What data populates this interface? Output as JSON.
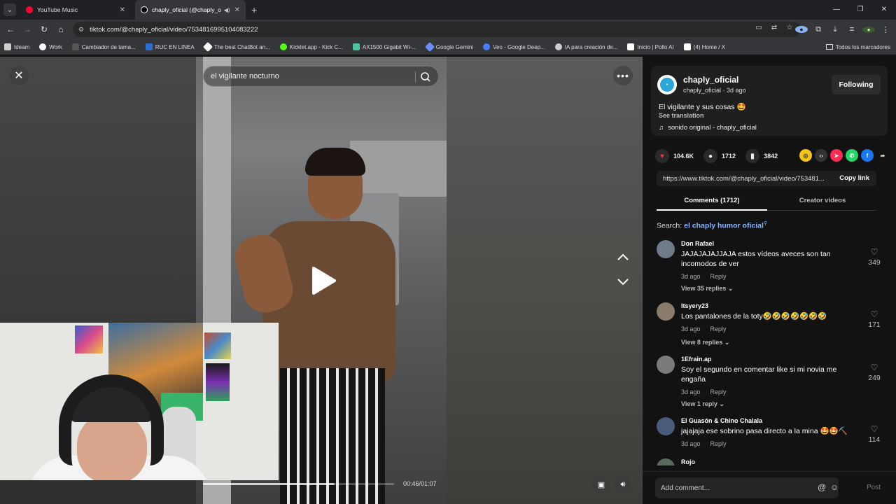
{
  "browser": {
    "tabs": [
      {
        "title": "YouTube Music",
        "favicon_color": "#ff0033",
        "active": false
      },
      {
        "title": "chaply_oficial (@chaply_oficial)",
        "favicon_color": "#000000",
        "active": true
      }
    ],
    "url": "tiktok.com/@chaply_oficial/video/7534816995104083222",
    "bookmarks": [
      {
        "label": "Ideam",
        "color": "#cfcfcf"
      },
      {
        "label": "Work",
        "color": "#ffffff"
      },
      {
        "label": "Cambiador de tama...",
        "color": "#555555"
      },
      {
        "label": "RUC EN LINEA",
        "color": "#2a6fd8"
      },
      {
        "label": "The best ChatBot an...",
        "color": "#ffffff"
      },
      {
        "label": "Kicklet.app - Kick C...",
        "color": "#53fc18"
      },
      {
        "label": "AX1500 Gigabit Wi-...",
        "color": "#4ac2a0"
      },
      {
        "label": "Google Gemini",
        "color": "#6b8cff"
      },
      {
        "label": "Veo - Google Deep...",
        "color": "#4a7bff"
      },
      {
        "label": "IA para creación de...",
        "color": "#cccccc"
      },
      {
        "label": "Inicio | Pollo AI",
        "color": "#ffffff"
      },
      {
        "label": "(4) Home / X",
        "color": "#ffffff"
      }
    ],
    "all_bookmarks": "Todos los marcadores"
  },
  "video": {
    "search_text": "el vigilante nocturno",
    "timecode": "00:46/01:07",
    "progress": 0.69
  },
  "author": {
    "name": "chaply_oficial",
    "sub": "chaply_oficial · 3d ago",
    "follow_label": "Following",
    "caption": "El vigilante y sus cosas 🤩",
    "see_translation": "See translation",
    "music": "sonido original - chaply_oficial"
  },
  "stats": {
    "likes": "104.6K",
    "comments": "1712",
    "saves": "3842"
  },
  "share_link": {
    "url": "https://www.tiktok.com/@chaply_oficial/video/753481...",
    "copy_label": "Copy link"
  },
  "panel_tabs": {
    "comments": "Comments (1712)",
    "creator": "Creator videos"
  },
  "search_suggestion": {
    "prefix": "Search:",
    "keyword": "el chaply humor oficial"
  },
  "comments": [
    {
      "user": "Don Rafael",
      "text": "JAJAJAJAJJAJA estos vídeos aveces son tan incomodos de ver",
      "time": "3d ago",
      "reply": "Reply",
      "view": "View 35 replies",
      "likes": "349",
      "avatar_color": "#6f7b8a"
    },
    {
      "user": "Itsyery23",
      "text": "Los pantalones de la toty🤣🤣🤣🤣🤣🤣🤣",
      "time": "3d ago",
      "reply": "Reply",
      "view": "View 8 replies",
      "likes": "171",
      "avatar_color": "#8a7a6a"
    },
    {
      "user": "1Efrain.ap",
      "text": "Soy el segundo en comentar like si mi novia me engaña",
      "time": "3d ago",
      "reply": "Reply",
      "view": "View 1 reply",
      "likes": "249",
      "avatar_color": "#7a7a7a"
    },
    {
      "user": "El Guasón & Chino Chalala",
      "text": "jajajaja ese sobrino pasa directo a la mina 🤩🤩⛏️",
      "time": "3d ago",
      "reply": "Reply",
      "view": "",
      "likes": "114",
      "avatar_color": "#4a5a7a"
    },
    {
      "user": "Rojo",
      "text": "",
      "time": "",
      "reply": "",
      "view": "",
      "likes": "",
      "avatar_color": "#5a6a5a"
    }
  ],
  "comment_bar": {
    "placeholder": "Add comment...",
    "post_label": "Post"
  }
}
